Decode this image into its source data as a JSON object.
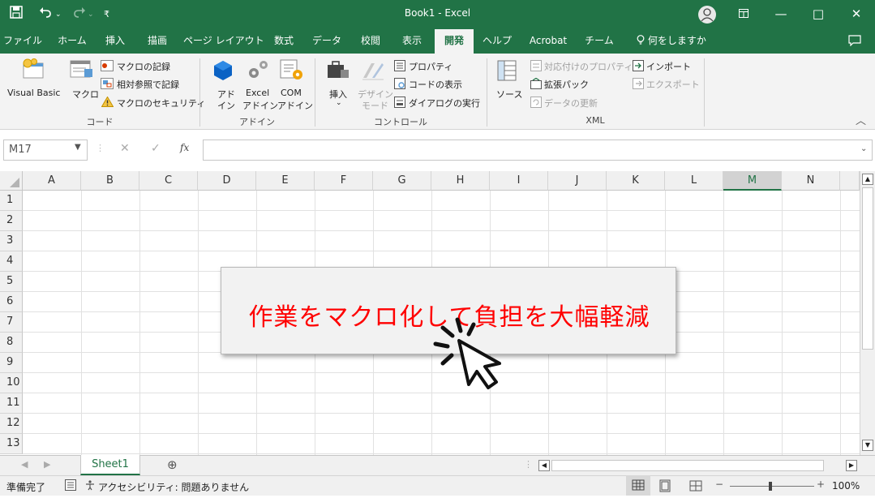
{
  "titlebar": {
    "title": "Book1 - Excel",
    "save_icon": "save-icon",
    "undo_icon": "undo-icon",
    "redo_icon": "redo-icon",
    "customize_icon": "customize-qat-icon"
  },
  "menu": {
    "tabs": [
      "ファイル",
      "ホーム",
      "挿入",
      "描画",
      "ページ レイアウト",
      "数式",
      "データ",
      "校閲",
      "表示",
      "開発",
      "ヘルプ",
      "Acrobat",
      "チーム"
    ],
    "active": "開発",
    "tell_me": "何をしますか"
  },
  "ribbon": {
    "code": {
      "visual_basic": "Visual Basic",
      "macro": "マクロ",
      "record_macro": "マクロの記録",
      "relative_ref": "相対参照で記録",
      "macro_security": "マクロのセキュリティ",
      "group_label": "コード"
    },
    "addins": {
      "addin_line1": "アド",
      "addin_line2": "イン",
      "excel_line1": "Excel",
      "excel_line2": "アドイン",
      "com_line1": "COM",
      "com_line2": "アドイン",
      "group_label": "アドイン"
    },
    "controls": {
      "insert": "挿入",
      "design_line1": "デザイン",
      "design_line2": "モード",
      "properties": "プロパティ",
      "view_code": "コードの表示",
      "run_dialog": "ダイアログの実行",
      "group_label": "コントロール"
    },
    "xml": {
      "source": "ソース",
      "map_properties": "対応付けのプロパティ",
      "expansion_packs": "拡張パック",
      "refresh_data": "データの更新",
      "import": "インポート",
      "export": "エクスポート",
      "group_label": "XML"
    }
  },
  "formula_bar": {
    "name_box": "M17",
    "fx": "fx",
    "value": ""
  },
  "grid": {
    "columns": [
      "A",
      "B",
      "C",
      "D",
      "E",
      "F",
      "G",
      "H",
      "I",
      "J",
      "K",
      "L",
      "M",
      "N"
    ],
    "selected_column": "M",
    "rows": [
      "1",
      "2",
      "3",
      "4",
      "5",
      "6",
      "7",
      "8",
      "9",
      "10",
      "11",
      "12",
      "13"
    ]
  },
  "sheets": {
    "tabs": [
      "Sheet1"
    ],
    "add_label": "⊕"
  },
  "status": {
    "ready": "準備完了",
    "accessibility": "アクセシビリティ: 問題ありません",
    "zoom": "100%"
  },
  "overlay": {
    "banner_text": "作業をマクロ化して負担を大幅軽減",
    "cursor_icon": "click-cursor-icon"
  },
  "colors": {
    "excel_green": "#217346",
    "banner_text": "#ff0000"
  }
}
